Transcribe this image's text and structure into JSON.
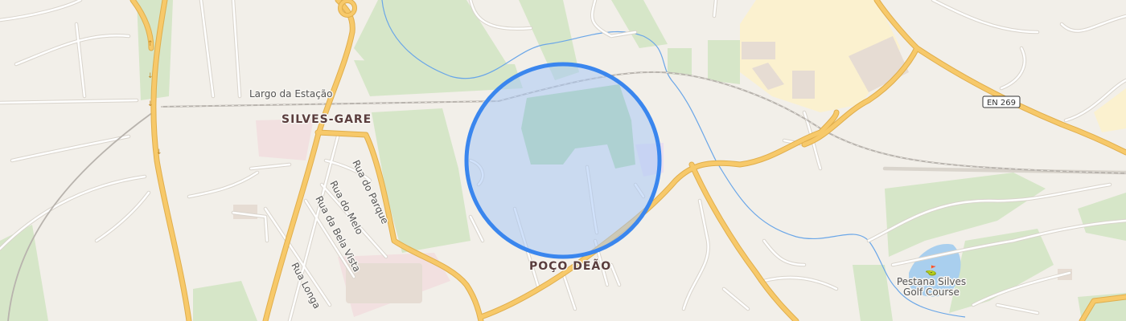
{
  "map": {
    "colors": {
      "background": "#f2efe9",
      "major_road": "#f7c96a",
      "major_road_casing": "#e0ae4c",
      "minor_road": "#ffffff",
      "minor_road_casing": "#d9d4cc",
      "railway": "#b8b3ad",
      "river": "#6aa6e8",
      "park": "#d6e6c8",
      "industrial": "#fbf1cf",
      "water": "#a9cfee",
      "building": "#e6dcd3",
      "selection_fill": "#a9c8f5",
      "selection_stroke": "#3a86ee"
    },
    "labels": {
      "largo_da_estacao": "Largo da Estação",
      "silves_gare": "SILVES-GARE",
      "poco_deao": "POÇO DEÃO",
      "rua_do_parque": "Rua do Parque",
      "rua_do_melo": "Rua do Melo",
      "rua_da_bela_vista": "Rua da Bela Vista",
      "rua_longa": "Rua Longa",
      "golf_line1": "Pestana Silves",
      "golf_line2": "Golf Course"
    },
    "road_shield": "EN 269",
    "icons": {
      "golf": "golf-icon"
    }
  }
}
